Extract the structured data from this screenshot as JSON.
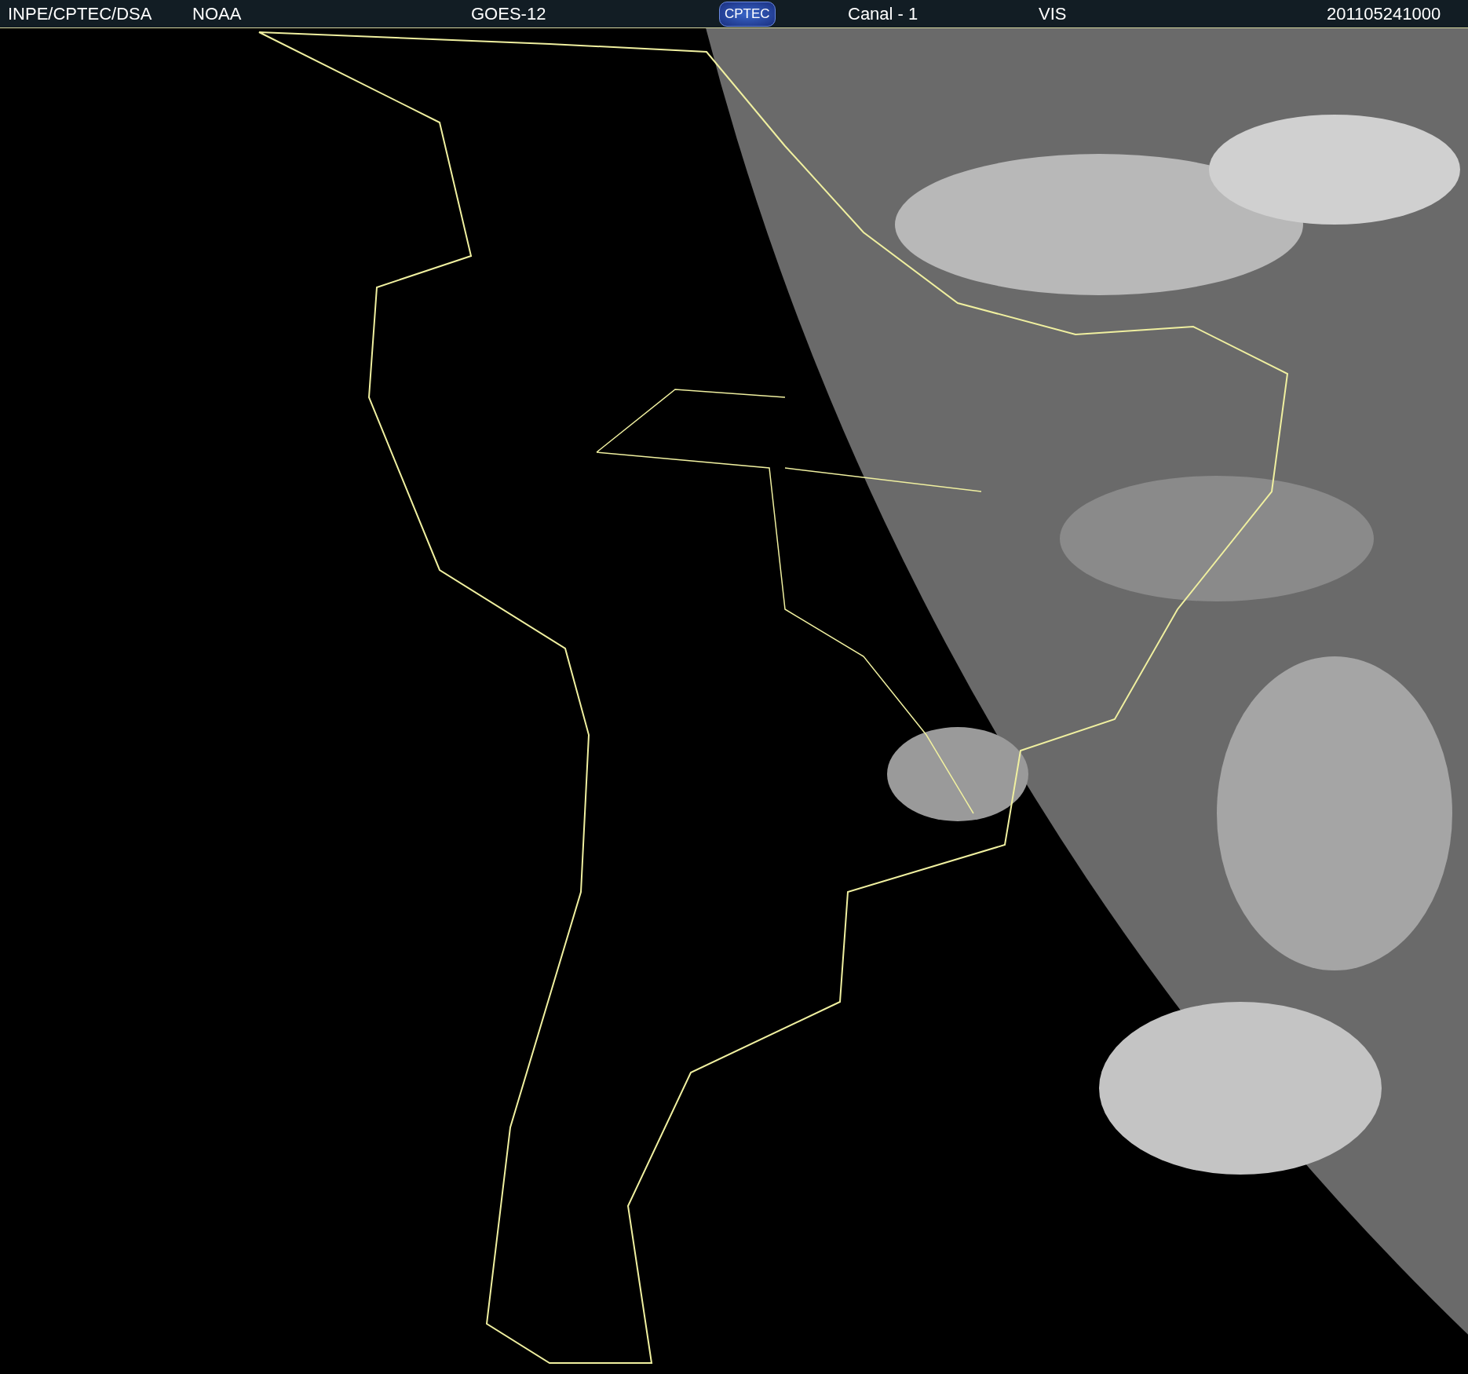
{
  "header": {
    "items": [
      {
        "kind": "text",
        "text": "INPE/CPTEC/DSA"
      },
      {
        "kind": "text",
        "text": "NOAA"
      },
      {
        "kind": "text",
        "text": "GOES-12"
      },
      {
        "kind": "logo",
        "text": "CPTEC"
      },
      {
        "kind": "text",
        "text": "Canal - 1"
      },
      {
        "kind": "text",
        "text": "VIS"
      },
      {
        "kind": "text",
        "text": "201105241000"
      }
    ]
  }
}
